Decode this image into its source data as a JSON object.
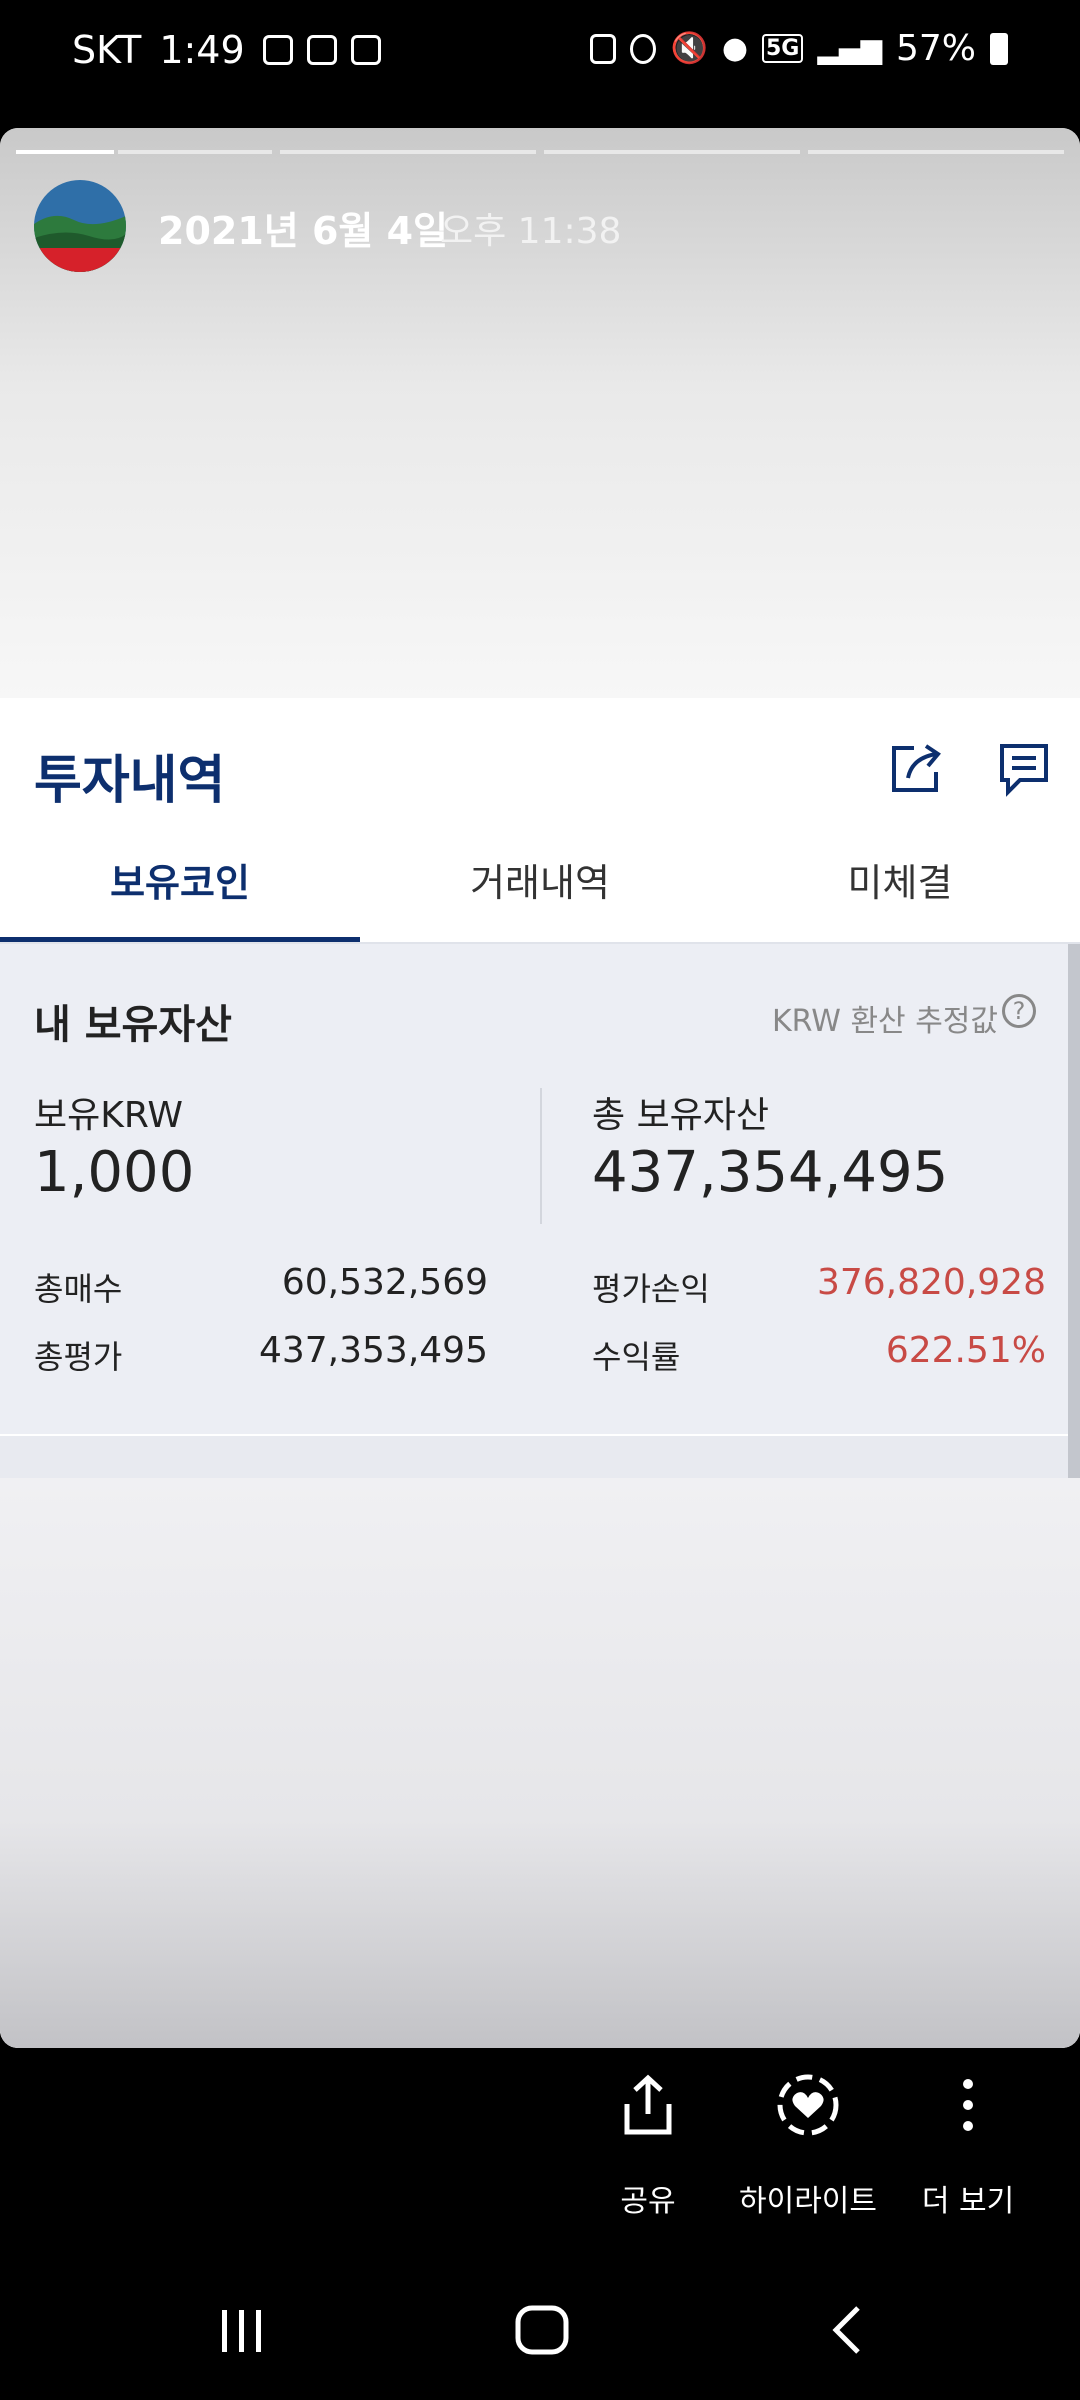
{
  "status_bar": {
    "carrier": "SKT",
    "time": "1:49",
    "network": "5G",
    "battery": "57%"
  },
  "story": {
    "date": "2021년 6월 4일",
    "time": "오후 11:38",
    "progress_segments": 5,
    "active_segment": 1
  },
  "app": {
    "title": "투자내역",
    "tabs": [
      "보유코인",
      "거래내역",
      "미체결"
    ],
    "active_tab": 0,
    "assets": {
      "section_title": "내 보유자산",
      "note": "KRW 환산 추정값",
      "help": "?",
      "krw_label": "보유KRW",
      "krw_value": "1,000",
      "total_label": "총 보유자산",
      "total_value": "437,354,495",
      "rows": [
        {
          "label": "총매수",
          "value": "60,532,569"
        },
        {
          "label": "총평가",
          "value": "437,353,495"
        },
        {
          "label": "평가손익",
          "value": "376,820,928"
        },
        {
          "label": "수익률",
          "value": "622.51%"
        }
      ]
    }
  },
  "colors": {
    "brand": "#0d2f6e",
    "positive": "#c84a45"
  },
  "actions": [
    {
      "label": "공유",
      "icon": "share-icon"
    },
    {
      "label": "하이라이트",
      "icon": "highlight-icon"
    },
    {
      "label": "더 보기",
      "icon": "more-icon"
    }
  ],
  "nav": [
    "recent-apps-icon",
    "home-icon",
    "back-icon"
  ]
}
